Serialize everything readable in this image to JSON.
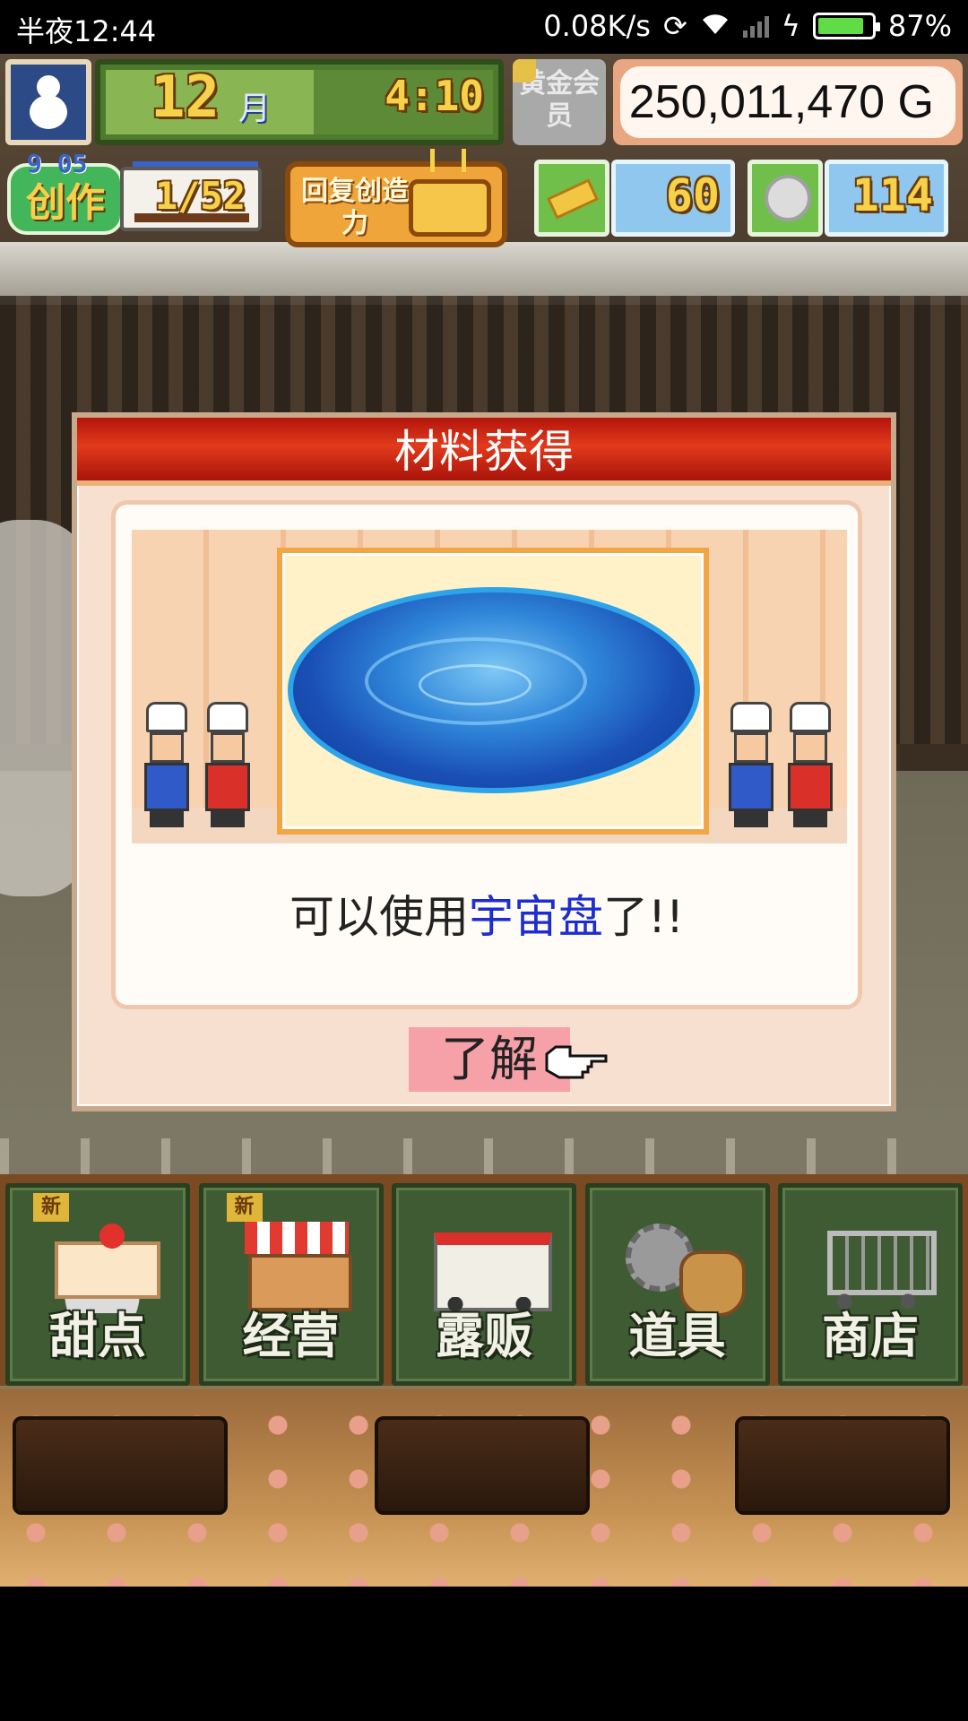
{
  "status_bar": {
    "time": "半夜12:44",
    "net_speed": "0.08K/s",
    "battery_percent": "87%",
    "battery_level": 0.87,
    "icons": [
      "sync-icon",
      "wifi-icon",
      "signal-icon",
      "charging-icon",
      "battery-icon"
    ]
  },
  "hud": {
    "month_number": "12",
    "month_unit": "月",
    "clock": "4:10",
    "gold_member_label": "黄金会员",
    "money": "250,011,470 G",
    "create_tag": "创作",
    "create_level": "9 05",
    "create_count": "1/52",
    "restore_label": "回复创造力",
    "ticket_value": "60",
    "coin_value": "114"
  },
  "dialog": {
    "title": "材料获得",
    "message_prefix": "可以使用",
    "message_highlight": "宇宙盘",
    "message_suffix": "了!!",
    "ok_label": "了解"
  },
  "menu": {
    "new_badge": "新",
    "items": [
      {
        "label": "甜点",
        "icon": "cake-icon",
        "is_new": true
      },
      {
        "label": "经营",
        "icon": "shop-icon",
        "is_new": true
      },
      {
        "label": "露贩",
        "icon": "food-truck-icon",
        "is_new": false
      },
      {
        "label": "道具",
        "icon": "tools-icon",
        "is_new": false
      },
      {
        "label": "商店",
        "icon": "cart-icon",
        "is_new": false
      }
    ]
  },
  "colors": {
    "dialog_title_red": "#d22a16",
    "highlight_blue": "#1d2dd0",
    "ok_button_pink": "#f6a0a8"
  }
}
